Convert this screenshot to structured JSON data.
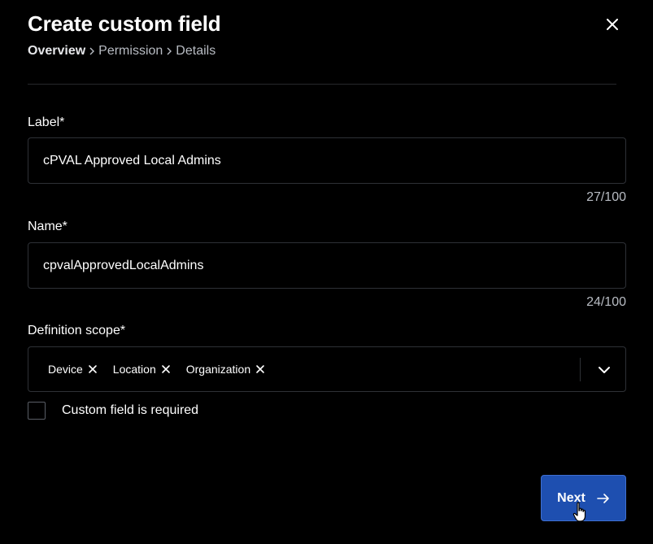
{
  "modal": {
    "title": "Create custom field",
    "close_icon": "close-icon"
  },
  "breadcrumb": {
    "items": [
      {
        "label": "Overview",
        "active": true
      },
      {
        "label": "Permission",
        "active": false
      },
      {
        "label": "Details",
        "active": false
      }
    ],
    "separator_icon": "chevron-right-icon"
  },
  "form": {
    "label_field": {
      "label": "Label*",
      "value": "cPVAL Approved Local Admins",
      "counter": "27/100"
    },
    "name_field": {
      "label": "Name*",
      "value": "cpvalApprovedLocalAdmins",
      "counter": "24/100"
    },
    "scope_field": {
      "label": "Definition scope*",
      "chips": [
        {
          "label": "Device"
        },
        {
          "label": "Location"
        },
        {
          "label": "Organization"
        }
      ],
      "dropdown_icon": "chevron-down-icon"
    },
    "required_checkbox": {
      "label": "Custom field is required",
      "checked": false
    }
  },
  "footer": {
    "next_label": "Next",
    "next_icon": "arrow-right-icon"
  },
  "colors": {
    "background": "#000000",
    "primary_button": "#1e4fb0",
    "border": "#2e3136",
    "muted_text": "#b8bcc3"
  }
}
